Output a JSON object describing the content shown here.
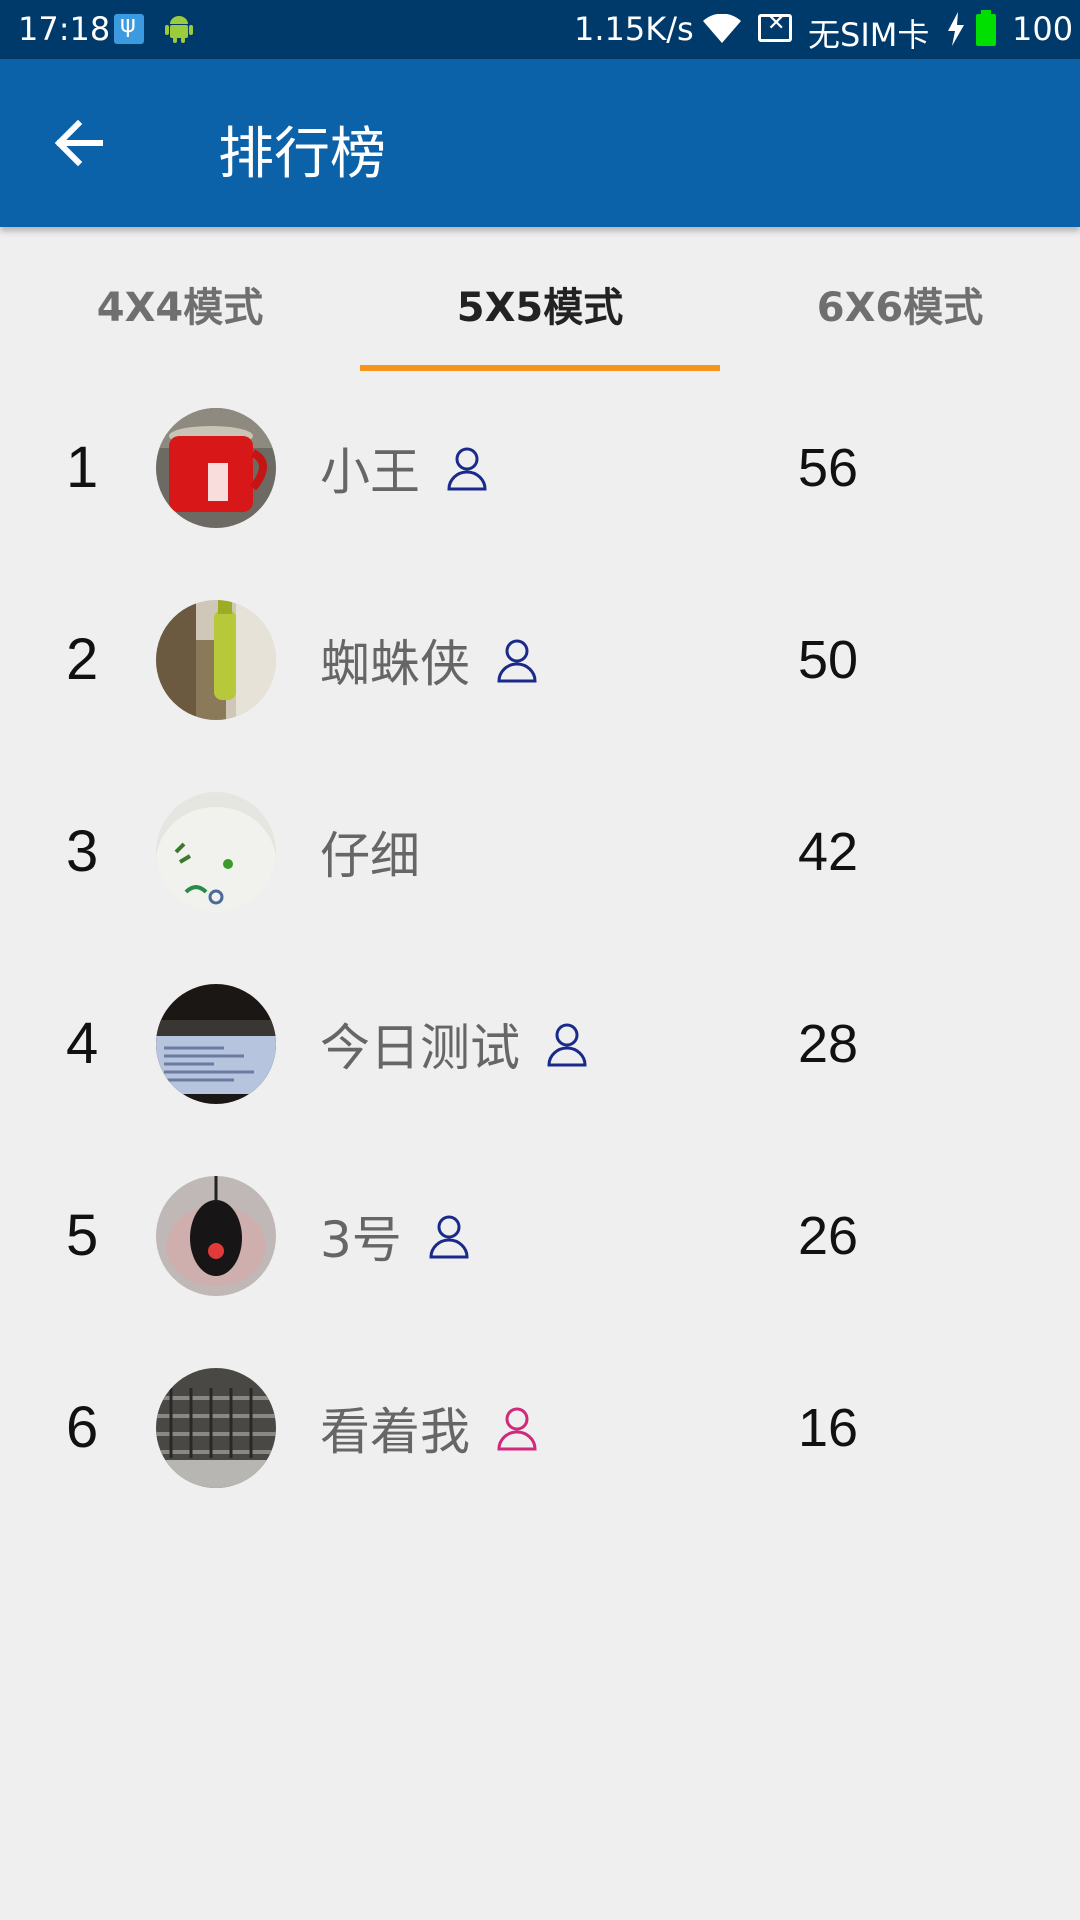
{
  "status_bar": {
    "time": "17:18",
    "speed": "1.15K/s",
    "carrier": "无SIM卡",
    "battery": "100"
  },
  "app_bar": {
    "title": "排行榜",
    "back_icon": "arrow-back-icon"
  },
  "tabs": [
    {
      "label": "4X4模式",
      "active": false
    },
    {
      "label": "5X5模式",
      "active": true
    },
    {
      "label": "6X6模式",
      "active": false
    }
  ],
  "colors": {
    "status_bar": "#003a6b",
    "app_bar": "#0b62a9",
    "tab_indicator": "#f7941d",
    "male_icon": "#1a2a8a",
    "female_icon": "#d0287a"
  },
  "leaderboard": [
    {
      "rank": "1",
      "name": "小王",
      "score": "56",
      "gender_icon": "male"
    },
    {
      "rank": "2",
      "name": "蜘蛛侠",
      "score": "50",
      "gender_icon": "male"
    },
    {
      "rank": "3",
      "name": "仔细",
      "score": "42",
      "gender_icon": "none"
    },
    {
      "rank": "4",
      "name": "今日测试",
      "score": "28",
      "gender_icon": "male"
    },
    {
      "rank": "5",
      "name": "3号",
      "score": "26",
      "gender_icon": "male"
    },
    {
      "rank": "6",
      "name": "看着我",
      "score": "16",
      "gender_icon": "female"
    }
  ]
}
